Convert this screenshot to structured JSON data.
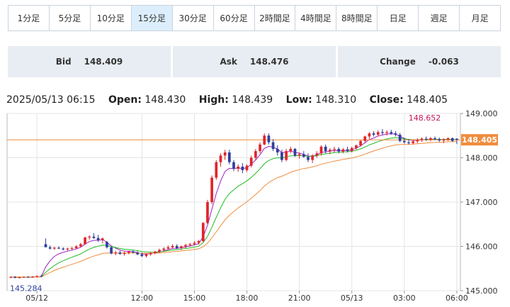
{
  "timeframes": {
    "items": [
      "1分足",
      "5分足",
      "10分足",
      "15分足",
      "30分足",
      "60分足",
      "2時間足",
      "4時間足",
      "8時間足",
      "日足",
      "週足",
      "月足"
    ],
    "active_index": 3
  },
  "quotes": {
    "bid_label": "Bid",
    "bid_value": "148.409",
    "ask_label": "Ask",
    "ask_value": "148.476",
    "change_label": "Change",
    "change_value": "-0.063"
  },
  "ohlc": {
    "datetime": "2025/05/13 06:15",
    "open_label": "Open:",
    "open_value": "148.430",
    "high_label": "High:",
    "high_value": "148.439",
    "low_label": "Low:",
    "low_value": "148.310",
    "close_label": "Close:",
    "close_value": "148.405"
  },
  "chart_data": {
    "type": "candlestick",
    "title": "",
    "ylim": [
      145.0,
      149.0
    ],
    "y_ticks": [
      "149.000",
      "148.000",
      "147.000",
      "146.000",
      "145.000"
    ],
    "y_tick_values": [
      149.0,
      148.0,
      147.0,
      146.0,
      145.0
    ],
    "x_ticks": [
      "05/12",
      "12:00",
      "15:00",
      "18:00",
      "21:00",
      "05/13",
      "03:00",
      "06:00"
    ],
    "x_tick_index": [
      6,
      30,
      42,
      54,
      66,
      78,
      90,
      102
    ],
    "current_price": 148.405,
    "current_price_label": "148.405",
    "max_label": "148.652",
    "max_value": 148.652,
    "max_index": 94,
    "min_label": "145.284",
    "min_value": 145.284,
    "min_index": 1,
    "up_color": "#e0252b",
    "down_color": "#2e3f9e",
    "current_line_color": "#f08c3c",
    "ma_colors": [
      "#a020c0",
      "#22bb22",
      "#f08c3c"
    ],
    "candles": [
      [
        145.3,
        145.33,
        145.28,
        145.31
      ],
      [
        145.31,
        145.33,
        145.28,
        145.29
      ],
      [
        145.29,
        145.32,
        145.28,
        145.3
      ],
      [
        145.3,
        145.32,
        145.29,
        145.31
      ],
      [
        145.31,
        145.33,
        145.29,
        145.3
      ],
      [
        145.3,
        145.33,
        145.29,
        145.32
      ],
      [
        145.32,
        145.35,
        145.3,
        145.33
      ],
      [
        145.33,
        145.36,
        145.31,
        145.32
      ],
      [
        146.05,
        146.18,
        146.02,
        145.98
      ],
      [
        145.98,
        146.02,
        145.93,
        145.95
      ],
      [
        145.95,
        145.99,
        145.92,
        145.97
      ],
      [
        145.97,
        146.0,
        145.94,
        145.95
      ],
      [
        145.95,
        145.98,
        145.91,
        145.93
      ],
      [
        145.93,
        145.97,
        145.9,
        145.95
      ],
      [
        145.95,
        145.99,
        145.92,
        145.96
      ],
      [
        145.96,
        146.03,
        145.94,
        146.0
      ],
      [
        146.0,
        146.08,
        145.98,
        146.05
      ],
      [
        146.05,
        146.22,
        146.03,
        146.2
      ],
      [
        146.2,
        146.25,
        146.15,
        146.22
      ],
      [
        146.22,
        146.3,
        146.17,
        146.19
      ],
      [
        146.19,
        146.26,
        146.1,
        146.14
      ],
      [
        146.14,
        146.2,
        146.07,
        146.18
      ],
      [
        146.1,
        146.12,
        145.95,
        145.98
      ],
      [
        145.98,
        146.0,
        145.82,
        145.84
      ],
      [
        145.84,
        145.9,
        145.8,
        145.86
      ],
      [
        145.86,
        145.9,
        145.81,
        145.83
      ],
      [
        145.83,
        145.88,
        145.79,
        145.85
      ],
      [
        145.85,
        145.9,
        145.82,
        145.88
      ],
      [
        145.88,
        145.92,
        145.84,
        145.86
      ],
      [
        145.86,
        145.89,
        145.8,
        145.82
      ],
      [
        145.82,
        145.86,
        145.76,
        145.78
      ],
      [
        145.78,
        145.84,
        145.75,
        145.82
      ],
      [
        145.82,
        145.87,
        145.79,
        145.85
      ],
      [
        145.85,
        145.9,
        145.82,
        145.88
      ],
      [
        145.88,
        145.95,
        145.85,
        145.92
      ],
      [
        145.92,
        145.98,
        145.88,
        145.95
      ],
      [
        145.95,
        146.02,
        145.92,
        145.98
      ],
      [
        145.98,
        146.05,
        145.95,
        146.01
      ],
      [
        146.01,
        146.05,
        145.94,
        145.96
      ],
      [
        145.96,
        146.02,
        145.92,
        146.0
      ],
      [
        146.0,
        146.06,
        145.96,
        146.03
      ],
      [
        146.03,
        146.08,
        145.99,
        146.05
      ],
      [
        146.05,
        146.12,
        146.02,
        146.08
      ],
      [
        146.08,
        146.15,
        146.04,
        146.12
      ],
      [
        146.12,
        146.55,
        146.1,
        146.53
      ],
      [
        146.53,
        147.05,
        146.5,
        147.0
      ],
      [
        147.0,
        147.6,
        146.95,
        147.55
      ],
      [
        147.55,
        147.95,
        147.5,
        147.9
      ],
      [
        147.9,
        148.1,
        147.8,
        148.05
      ],
      [
        148.05,
        148.18,
        147.95,
        148.12
      ],
      [
        148.12,
        148.18,
        147.85,
        147.9
      ],
      [
        147.9,
        147.95,
        147.7,
        147.75
      ],
      [
        147.75,
        147.85,
        147.68,
        147.8
      ],
      [
        147.8,
        147.88,
        147.65,
        147.72
      ],
      [
        147.72,
        147.85,
        147.68,
        147.82
      ],
      [
        147.82,
        148.05,
        147.78,
        148.0
      ],
      [
        148.0,
        148.2,
        147.95,
        148.15
      ],
      [
        148.15,
        148.35,
        148.1,
        148.3
      ],
      [
        148.3,
        148.55,
        148.28,
        148.5
      ],
      [
        148.5,
        148.55,
        148.3,
        148.35
      ],
      [
        148.35,
        148.42,
        148.15,
        148.2
      ],
      [
        148.2,
        148.28,
        148.05,
        148.12
      ],
      [
        148.12,
        148.18,
        147.9,
        147.95
      ],
      [
        147.95,
        148.2,
        147.92,
        148.15
      ],
      [
        148.15,
        148.25,
        148.1,
        148.2
      ],
      [
        148.2,
        148.22,
        148.02,
        148.05
      ],
      [
        148.05,
        148.12,
        147.98,
        148.08
      ],
      [
        148.08,
        148.15,
        148.0,
        148.02
      ],
      [
        148.02,
        148.1,
        147.9,
        147.95
      ],
      [
        147.95,
        148.08,
        147.88,
        148.05
      ],
      [
        148.05,
        148.15,
        148.0,
        148.1
      ],
      [
        148.1,
        148.28,
        148.05,
        148.25
      ],
      [
        148.25,
        148.3,
        148.1,
        148.15
      ],
      [
        148.15,
        148.22,
        148.08,
        148.18
      ],
      [
        148.18,
        148.25,
        148.12,
        148.2
      ],
      [
        148.2,
        148.24,
        148.1,
        148.14
      ],
      [
        148.14,
        148.22,
        148.1,
        148.19
      ],
      [
        148.19,
        148.25,
        148.12,
        148.15
      ],
      [
        148.15,
        148.25,
        148.12,
        148.22
      ],
      [
        148.22,
        148.3,
        148.18,
        148.28
      ],
      [
        148.28,
        148.4,
        148.25,
        148.38
      ],
      [
        148.38,
        148.5,
        148.35,
        148.48
      ],
      [
        148.48,
        148.58,
        148.42,
        148.55
      ],
      [
        148.55,
        148.6,
        148.48,
        148.52
      ],
      [
        148.52,
        148.62,
        148.48,
        148.58
      ],
      [
        148.58,
        148.65,
        148.52,
        148.56
      ],
      [
        148.56,
        148.62,
        148.5,
        148.58
      ],
      [
        148.58,
        148.63,
        148.52,
        148.55
      ],
      [
        148.55,
        148.6,
        148.48,
        148.52
      ],
      [
        148.52,
        148.56,
        148.35,
        148.38
      ],
      [
        148.38,
        148.45,
        148.32,
        148.35
      ],
      [
        148.35,
        148.42,
        148.3,
        148.33
      ],
      [
        148.33,
        148.4,
        148.3,
        148.37
      ],
      [
        148.37,
        148.44,
        148.33,
        148.4
      ],
      [
        148.4,
        148.46,
        148.36,
        148.43
      ],
      [
        148.43,
        148.48,
        148.38,
        148.41
      ],
      [
        148.41,
        148.47,
        148.37,
        148.44
      ],
      [
        148.44,
        148.48,
        148.4,
        148.42
      ],
      [
        148.42,
        148.46,
        148.36,
        148.39
      ],
      [
        148.39,
        148.44,
        148.33,
        148.41
      ],
      [
        148.41,
        148.46,
        148.38,
        148.44
      ],
      [
        148.44,
        148.46,
        148.36,
        148.38
      ],
      [
        148.43,
        148.44,
        148.31,
        148.405
      ]
    ]
  }
}
